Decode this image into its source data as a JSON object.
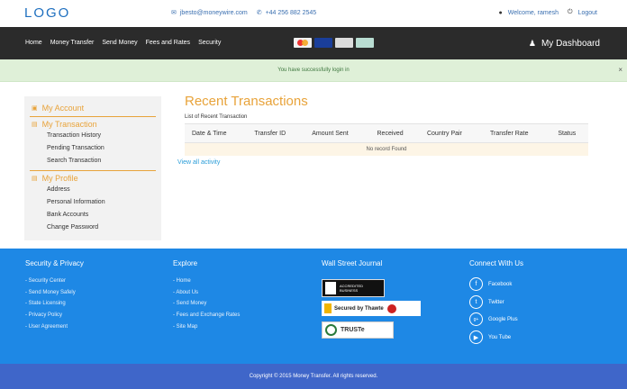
{
  "header": {
    "logo": "LOGO",
    "email": "jbesto@moneywire.com",
    "phone": "+44 256 882 2545",
    "welcome": "Welcome, ramesh",
    "logout": "Logout"
  },
  "nav": {
    "items": [
      "Home",
      "Money Transfer",
      "Send Money",
      "Fees and Rates",
      "Security"
    ],
    "dashboard": "My Dashboard"
  },
  "payment_cards": [
    {
      "name": "mastercard",
      "color": "#f2f2f2"
    },
    {
      "name": "visa",
      "color": "#1a3e9a"
    },
    {
      "name": "amex",
      "color": "#dcdcdc"
    },
    {
      "name": "generic-card",
      "color": "#b9ddd2"
    }
  ],
  "alert": {
    "message": "You have successfully login in",
    "close": "×"
  },
  "sidebar": {
    "account": "My Account",
    "transaction": "My Transaction",
    "transaction_items": [
      "Transaction History",
      "Pending Transaction",
      "Search Transaction"
    ],
    "profile": "My Profile",
    "profile_items": [
      "Address",
      "Personal Information",
      "Bank Accounts",
      "Change Password"
    ]
  },
  "main": {
    "title": "Recent Transactions",
    "subtitle": "List of Recent Transaction",
    "columns": [
      "Date & Time",
      "Transfer ID",
      "Amount Sent",
      "Received",
      "Country Pair",
      "Transfer Rate",
      "Status"
    ],
    "empty_message": "No record Found",
    "view_all": "View all activity"
  },
  "footer": {
    "security": {
      "heading": "Security & Privacy",
      "links": [
        "Security Center",
        "Send Money Safely",
        "State Licensing",
        "Privacy Policy",
        "User Agreement"
      ]
    },
    "explore": {
      "heading": "Explore",
      "links": [
        "Home",
        "About Us",
        "Send Money",
        "Fees and Exchange Rates",
        "Site Map"
      ]
    },
    "wsj": {
      "heading": "Wall Street Journal",
      "badges": [
        "ACCREDITED BUSINESS",
        "Secured by Thawte",
        "TRUSTe"
      ]
    },
    "connect": {
      "heading": "Connect With Us",
      "items": [
        "Facebook",
        "Twitter",
        "Google Plus",
        "You Tube"
      ]
    },
    "copyright": "Copyright © 2015 Money Transfer. All rights reserved."
  }
}
